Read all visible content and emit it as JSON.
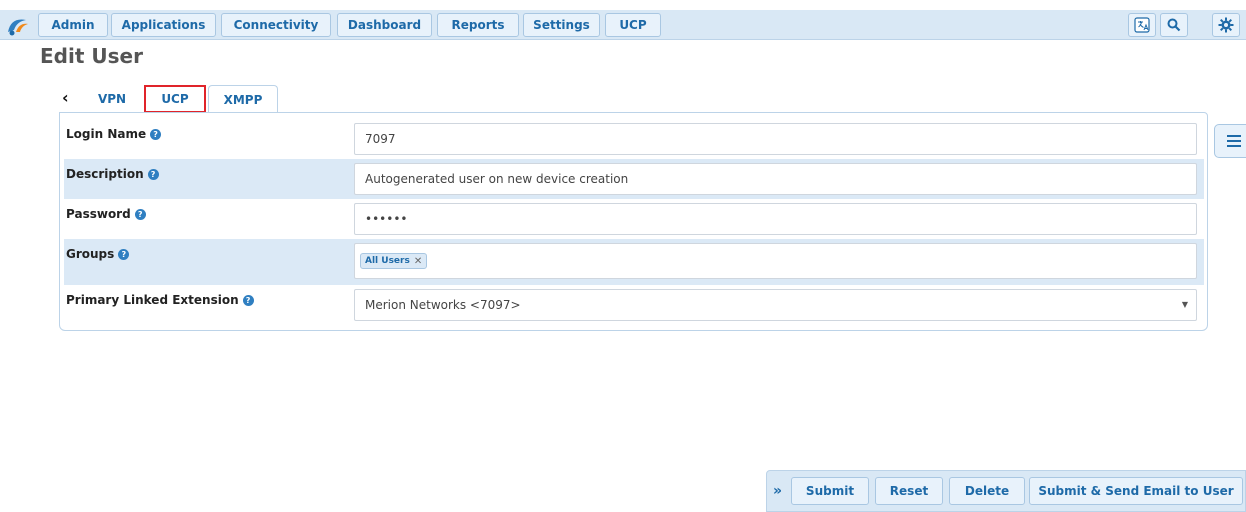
{
  "nav": {
    "items": [
      "Admin",
      "Applications",
      "Connectivity",
      "Dashboard",
      "Reports",
      "Settings",
      "UCP"
    ],
    "icons": [
      "language-icon",
      "search-icon",
      "gear-icon"
    ]
  },
  "page": {
    "title": "Edit User"
  },
  "tabs": {
    "items": [
      "VPN",
      "UCP",
      "XMPP"
    ],
    "active": "UCP"
  },
  "form": {
    "login_name": {
      "label": "Login Name",
      "value": "7097"
    },
    "description": {
      "label": "Description",
      "value": "Autogenerated user on new device creation"
    },
    "password": {
      "label": "Password",
      "value": "••••••"
    },
    "groups": {
      "label": "Groups",
      "chip": "All Users",
      "chip_remove": "✕"
    },
    "primary_ext": {
      "label": "Primary Linked Extension",
      "value": "Merion Networks <7097>"
    },
    "help_glyph": "?"
  },
  "actions": {
    "toggle": "»",
    "submit": "Submit",
    "reset": "Reset",
    "delete": "Delete",
    "submit_email": "Submit & Send Email to User"
  },
  "colors": {
    "accent": "#1e6aa8",
    "nav_bg": "#d9e8f5",
    "row_alt": "#dbe9f6",
    "tab_highlight": "#e0242a"
  }
}
